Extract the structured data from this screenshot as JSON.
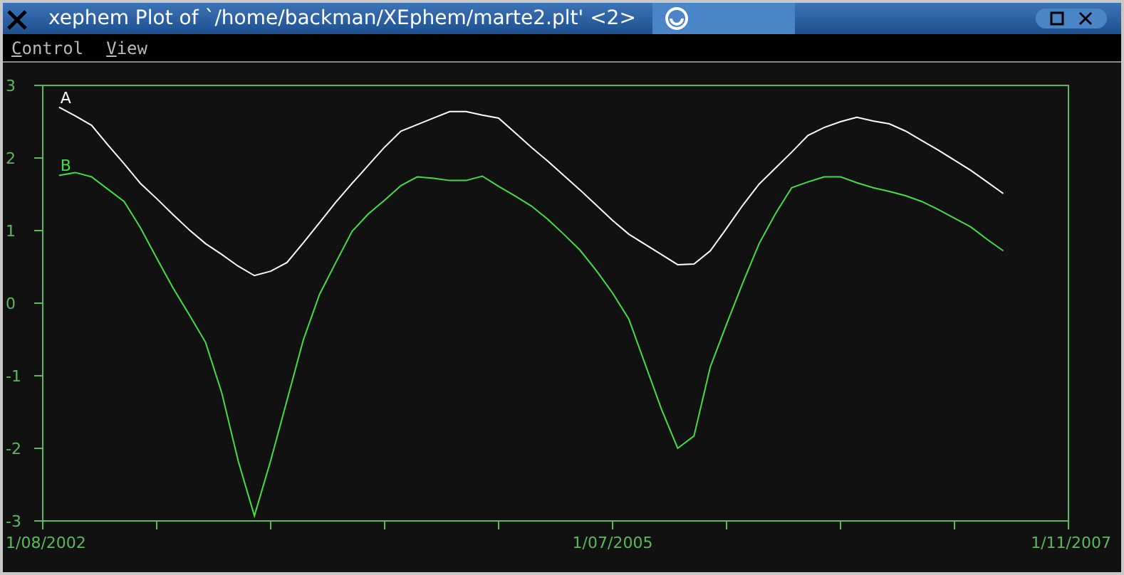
{
  "window": {
    "title": "xephem Plot of `/home/backman/XEphem/marte2.plt' <2>"
  },
  "menu": [
    {
      "label": "Control"
    },
    {
      "label": "View"
    }
  ],
  "plot": {
    "chart_data": {
      "type": "line",
      "ylim": [
        -3,
        3
      ],
      "yticks": [
        3,
        2,
        1,
        0,
        -1,
        -2,
        -3
      ],
      "categories": [
        "1/08/2002",
        null,
        null,
        null,
        null,
        null,
        null,
        null,
        null,
        null,
        null,
        null,
        null,
        null,
        null,
        null,
        null,
        null,
        null,
        null,
        null,
        null,
        null,
        null,
        null,
        null,
        null,
        null,
        null,
        null,
        null,
        null,
        null,
        null,
        null,
        "1/07/2005",
        null,
        null,
        null,
        null,
        null,
        null,
        null,
        null,
        null,
        null,
        null,
        null,
        null,
        null,
        null,
        null,
        null,
        null,
        null,
        null,
        null,
        null,
        null,
        null,
        null,
        null,
        null,
        "1/11/2007"
      ],
      "series": [
        {
          "name": "A",
          "color": "#ffffff",
          "values": [
            null,
            2.7,
            2.58,
            2.45,
            2.18,
            1.92,
            1.65,
            1.44,
            1.22,
            1.01,
            0.82,
            0.67,
            0.51,
            0.38,
            0.44,
            0.56,
            0.83,
            1.11,
            1.39,
            1.65,
            1.9,
            2.15,
            2.37,
            2.46,
            2.55,
            2.64,
            2.64,
            2.59,
            2.55,
            2.35,
            2.15,
            1.96,
            1.76,
            1.56,
            1.35,
            1.14,
            0.95,
            0.81,
            0.67,
            0.53,
            0.54,
            0.72,
            1.03,
            1.35,
            1.64,
            1.86,
            2.08,
            2.31,
            2.42,
            2.5,
            2.56,
            2.51,
            2.47,
            2.37,
            2.24,
            2.11,
            1.97,
            1.83,
            1.67,
            1.51,
            null,
            null,
            null,
            null
          ]
        },
        {
          "name": "B",
          "color": "#44dd44",
          "values": [
            null,
            1.76,
            1.8,
            1.74,
            1.57,
            1.4,
            1.04,
            0.62,
            0.21,
            -0.16,
            -0.54,
            -1.24,
            -2.17,
            -2.93,
            -2.17,
            -1.34,
            -0.51,
            0.12,
            0.56,
            0.99,
            1.23,
            1.42,
            1.62,
            1.74,
            1.72,
            1.69,
            1.69,
            1.75,
            1.61,
            1.48,
            1.34,
            1.16,
            0.95,
            0.73,
            0.45,
            0.14,
            -0.22,
            -0.84,
            -1.46,
            -2.0,
            -1.83,
            -0.88,
            -0.29,
            0.28,
            0.82,
            1.23,
            1.59,
            1.67,
            1.74,
            1.74,
            1.66,
            1.59,
            1.54,
            1.48,
            1.4,
            1.29,
            1.17,
            1.05,
            0.88,
            0.72,
            null,
            null,
            null,
            null
          ]
        }
      ]
    }
  }
}
